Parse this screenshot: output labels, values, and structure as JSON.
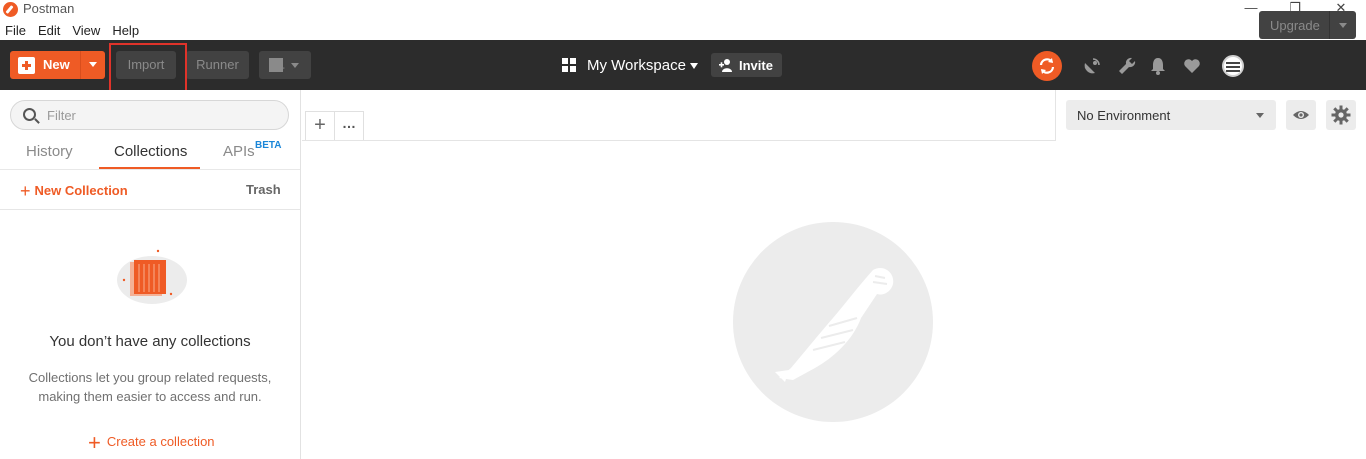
{
  "window": {
    "title": "Postman",
    "controls": {
      "minimize": "—",
      "restore": "❐",
      "close": "✕"
    }
  },
  "menu": [
    "File",
    "Edit",
    "View",
    "Help"
  ],
  "toolbar": {
    "new_label": "New",
    "import_label": "Import",
    "runner_label": "Runner",
    "workspace_name": "My Workspace",
    "invite_label": "Invite",
    "upgrade_label": "Upgrade",
    "icons": [
      "sync-icon",
      "satellite-icon",
      "wrench-icon",
      "bell-icon",
      "heart-icon",
      "avatar"
    ]
  },
  "sidebar": {
    "filter_placeholder": "Filter",
    "tabs": [
      {
        "label": "History",
        "active": false
      },
      {
        "label": "Collections",
        "active": true
      },
      {
        "label": "APIs",
        "active": false,
        "badge": "BETA"
      }
    ],
    "new_collection_label": "New Collection",
    "trash_label": "Trash",
    "empty_title": "You don’t have any collections",
    "empty_desc_line1": "Collections let you group related requests,",
    "empty_desc_line2": "making them easier to access and run.",
    "create_label": "Create a collection"
  },
  "main": {
    "environment": "No Environment"
  },
  "colors": {
    "accent": "#ef5b25",
    "toolbar_bg": "#2c2c2c",
    "beta": "#1a86d8",
    "highlight": "#e0332a"
  }
}
